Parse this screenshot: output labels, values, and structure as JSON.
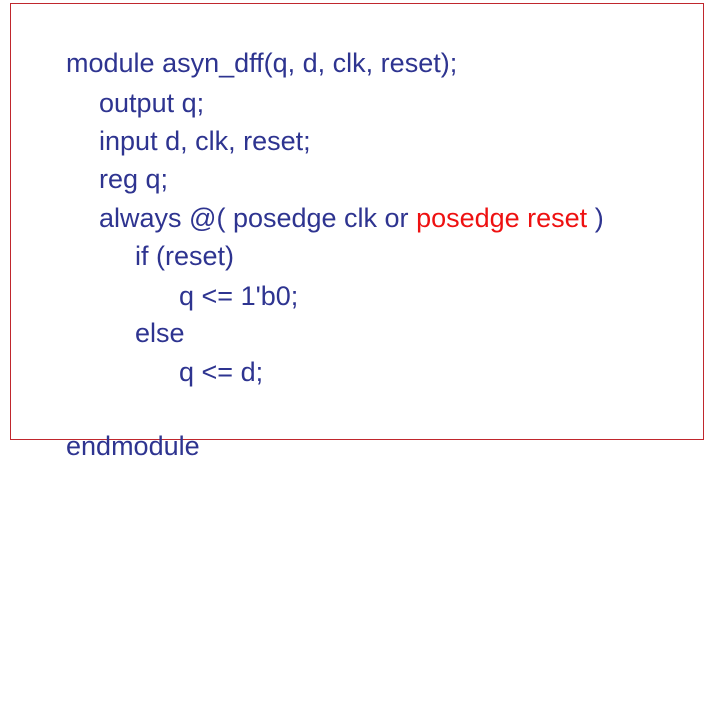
{
  "code": {
    "text_color": "#2e3490",
    "highlight_color": "#ee1111",
    "border_color": "#c0272d",
    "lines": [
      {
        "text": "module asyn_dff(q, d, clk, reset);"
      },
      {
        "text": "output q;"
      },
      {
        "text": "input d, clk, reset;"
      },
      {
        "text": "reg q;"
      },
      {
        "before": "always @( posedge clk or ",
        "highlight": "posedge reset",
        "after": " )"
      },
      {
        "text": "if (reset)"
      },
      {
        "text": "q <= 1'b0;"
      },
      {
        "text": "else"
      },
      {
        "text": "q <= d;"
      },
      {
        "text": "endmodule"
      }
    ]
  }
}
